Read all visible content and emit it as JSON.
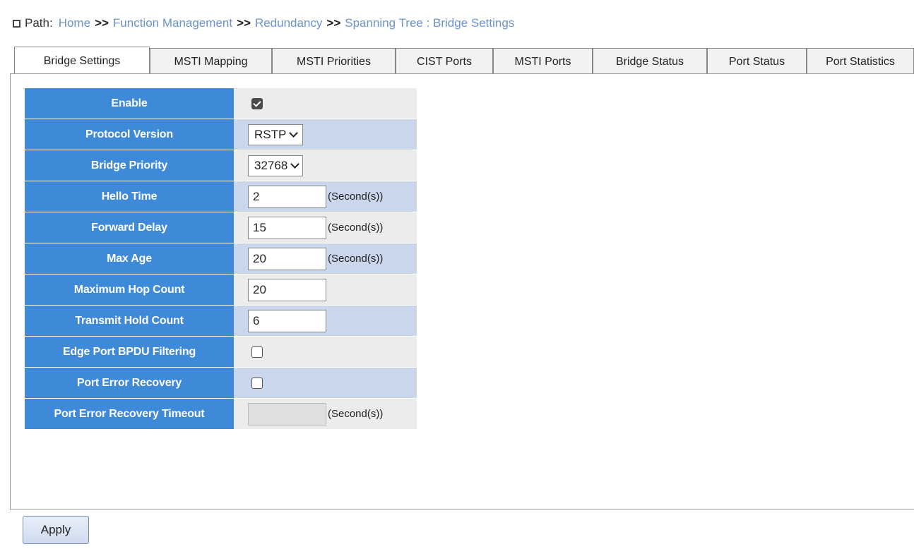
{
  "breadcrumb": {
    "label": "Path:",
    "items": [
      "Home",
      "Function Management",
      "Redundancy",
      "Spanning Tree : Bridge Settings"
    ],
    "separator": ">>"
  },
  "tabs": [
    {
      "label": "Bridge Settings",
      "active": true
    },
    {
      "label": "MSTI Mapping",
      "active": false
    },
    {
      "label": "MSTI Priorities",
      "active": false
    },
    {
      "label": "CIST Ports",
      "active": false
    },
    {
      "label": "MSTI Ports",
      "active": false
    },
    {
      "label": "Bridge Status",
      "active": false
    },
    {
      "label": "Port Status",
      "active": false
    },
    {
      "label": "Port Statistics",
      "active": false
    }
  ],
  "form": {
    "enable": {
      "label": "Enable",
      "checked": true
    },
    "protocol_version": {
      "label": "Protocol Version",
      "value": "RSTP"
    },
    "bridge_priority": {
      "label": "Bridge Priority",
      "value": "32768"
    },
    "hello_time": {
      "label": "Hello Time",
      "value": "2",
      "unit": "(Second(s))"
    },
    "forward_delay": {
      "label": "Forward Delay",
      "value": "15",
      "unit": "(Second(s))"
    },
    "max_age": {
      "label": "Max Age",
      "value": "20",
      "unit": "(Second(s))"
    },
    "max_hop_count": {
      "label": "Maximum Hop Count",
      "value": "20"
    },
    "transmit_hold_count": {
      "label": "Transmit Hold Count",
      "value": "6"
    },
    "edge_bpdu_filtering": {
      "label": "Edge Port BPDU Filtering",
      "checked": false
    },
    "port_error_recovery": {
      "label": "Port Error Recovery",
      "checked": false
    },
    "port_error_recovery_timeout": {
      "label": "Port Error Recovery Timeout",
      "value": "",
      "unit": "(Second(s))",
      "disabled": true
    }
  },
  "apply_label": "Apply",
  "colors": {
    "label_bg": "#3f8ad8",
    "row_odd": "#ececec",
    "row_even": "#cad6ec",
    "link": "#6c93c8"
  }
}
